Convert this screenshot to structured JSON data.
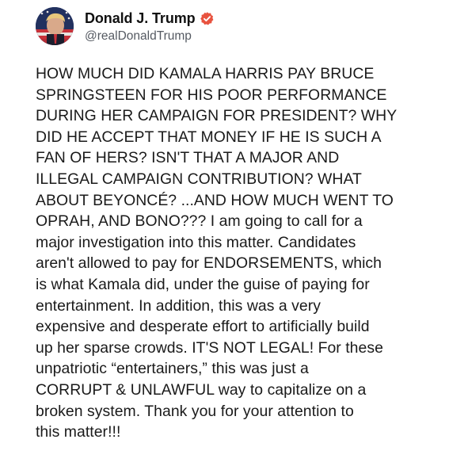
{
  "post": {
    "author": {
      "display_name": "Donald J. Trump",
      "handle": "@realDonaldTrump",
      "verified": true,
      "verified_badge_color": "#e8533f",
      "avatar_icon": "profile-photo"
    },
    "content": "HOW MUCH DID KAMALA HARRIS PAY BRUCE\nSPRINGSTEEN FOR HIS POOR PERFORMANCE\nDURING HER CAMPAIGN FOR PRESIDENT? WHY\nDID HE ACCEPT THAT MONEY IF HE IS SUCH A\nFAN OF HERS? ISN'T THAT A MAJOR AND\nILLEGAL CAMPAIGN CONTRIBUTION? WHAT\nABOUT BEYONCÉ? ...AND HOW MUCH WENT TO\nOPRAH, AND BONO??? I am going to call for a\nmajor investigation into this matter. Candidates\naren't allowed to pay for ENDORSEMENTS, which\nis what Kamala did, under the guise of paying for\nentertainment. In addition, this was a very\nexpensive and desperate effort to artificially build\nup her sparse crowds. IT'S NOT LEGAL! For these\nunpatriotic “entertainers,” this was just a\nCORRUPT & UNLAWFUL way to capitalize on a\nbroken system. Thank you for your attention to\nthis matter!!!"
  }
}
